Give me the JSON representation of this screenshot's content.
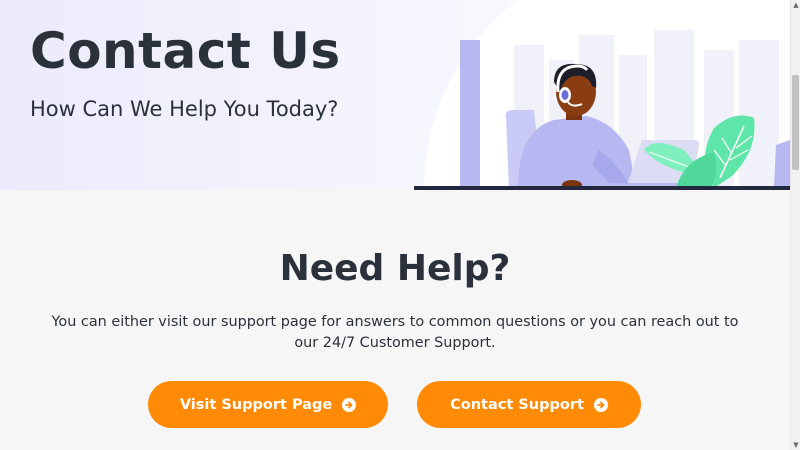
{
  "hero": {
    "title": "Contact Us",
    "subtitle": "How Can We Help You Today?"
  },
  "help": {
    "title": "Need Help?",
    "description": "You can either visit our support page for answers to common questions or you can reach out to our 24/7 Customer Support."
  },
  "buttons": {
    "visit_support": "Visit Support Page",
    "contact_support": "Contact Support"
  },
  "icons": {
    "button_arrow": "arrow-circle-right-icon",
    "illustration": "support-agent-illustration"
  },
  "colors": {
    "accent": "#ff8a05",
    "text": "#2b313b",
    "hero_bg": "#ecebfb",
    "illustration_purple": "#b7b8f2",
    "illustration_green": "#5ee6a8"
  }
}
